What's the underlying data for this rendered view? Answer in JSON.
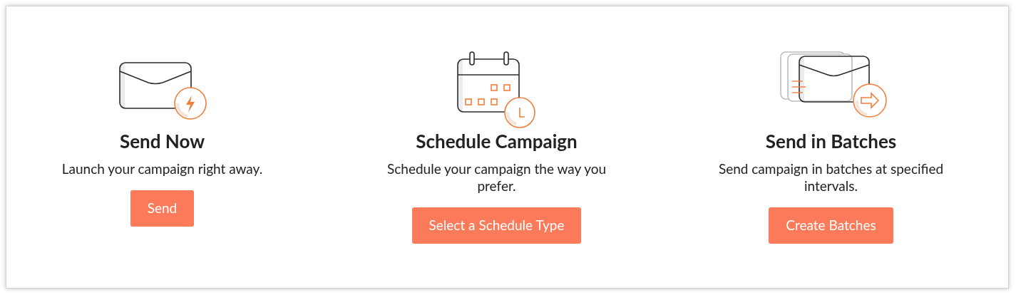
{
  "options": [
    {
      "kind": "envelope-bolt",
      "title": "Send Now",
      "description": "Launch your campaign right away.",
      "button": "Send"
    },
    {
      "kind": "calendar-clock",
      "title": "Schedule Campaign",
      "description": "Schedule your campaign the way you prefer.",
      "button": "Select a Schedule Type"
    },
    {
      "kind": "envelopes-arrow",
      "title": "Send in Batches",
      "description": "Send campaign in batches at specified intervals.",
      "button": "Create Batches"
    }
  ]
}
